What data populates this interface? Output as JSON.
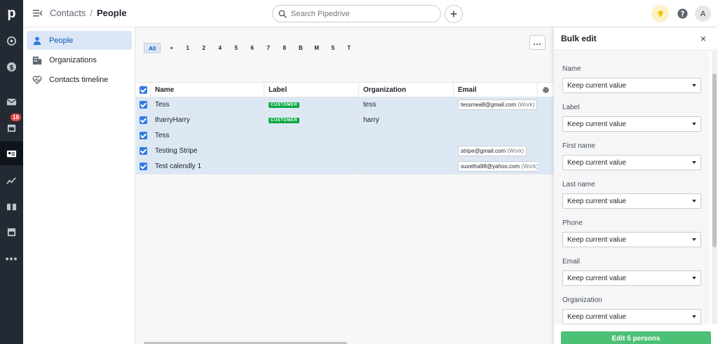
{
  "app": {
    "logo": "p"
  },
  "rail": {
    "badge_count": "18"
  },
  "topbar": {
    "breadcrumb_parent": "Contacts",
    "breadcrumb_sep": "/",
    "breadcrumb_current": "People",
    "search_placeholder": "Search Pipedrive",
    "add_label": "+",
    "avatar_initial": "A"
  },
  "sidenav": {
    "items": [
      {
        "label": "People",
        "icon": "person-icon",
        "active": true
      },
      {
        "label": "Organizations",
        "icon": "building-icon",
        "active": false
      },
      {
        "label": "Contacts timeline",
        "icon": "heartbeat-icon",
        "active": false
      }
    ]
  },
  "filter": {
    "letters": [
      "All",
      "+",
      "1",
      "2",
      "4",
      "5",
      "6",
      "7",
      "8",
      "B",
      "M",
      "S",
      "T"
    ],
    "more_label": "..."
  },
  "table": {
    "headers": {
      "name": "Name",
      "label": "Label",
      "organization": "Organization",
      "email": "Email"
    },
    "rows": [
      {
        "name": "Tess",
        "label": "CUSTOMER",
        "organization": "tess",
        "email": "tessmea8@gmail.com",
        "email_type": "(Work)"
      },
      {
        "name": "tharryHarry",
        "label": "CUSTOMER",
        "organization": "harry",
        "email": "",
        "email_type": ""
      },
      {
        "name": "Tess",
        "label": "",
        "organization": "",
        "email": "",
        "email_type": ""
      },
      {
        "name": "Testing Stripe",
        "label": "",
        "organization": "",
        "email": "stripe@gmail.com",
        "email_type": "(Work)"
      },
      {
        "name": "Test calendly 1",
        "label": "",
        "organization": "",
        "email": "suvetha98@yahoo.com",
        "email_type": "(Work)"
      }
    ]
  },
  "bulk_edit": {
    "title": "Bulk edit",
    "close": "×",
    "fields": [
      {
        "label": "Name",
        "value": "Keep current value"
      },
      {
        "label": "Label",
        "value": "Keep current value"
      },
      {
        "label": "First name",
        "value": "Keep current value"
      },
      {
        "label": "Last name",
        "value": "Keep current value"
      },
      {
        "label": "Phone",
        "value": "Keep current value"
      },
      {
        "label": "Email",
        "value": "Keep current value"
      },
      {
        "label": "Organization",
        "value": "Keep current value"
      }
    ],
    "submit_label": "Edit 5 persons"
  },
  "colors": {
    "accent": "#317ae2",
    "customer_tag": "#08a742",
    "submit": "#4cc074",
    "rail": "#232a34"
  }
}
